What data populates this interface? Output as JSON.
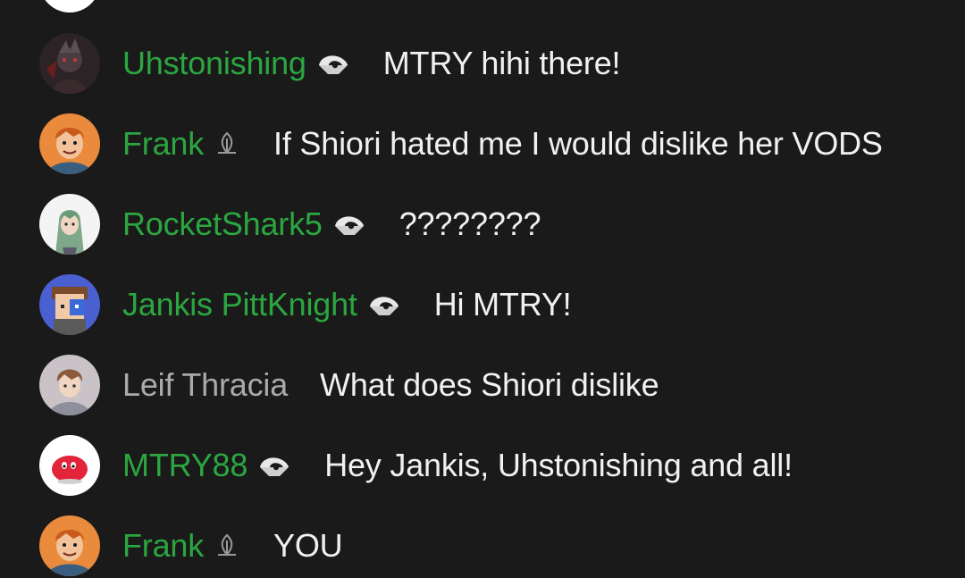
{
  "messages": [
    {
      "author": "Uhstonishing",
      "member": true,
      "badge": "member-badge-icon",
      "text": "MTRY hihi there!"
    },
    {
      "author": "Frank",
      "member": true,
      "badge": "sprout-badge-icon",
      "text": "If Shiori hated me I would dislike her VODS"
    },
    {
      "author": "RocketShark5",
      "member": true,
      "badge": "member-badge-icon",
      "text": "????????"
    },
    {
      "author": "Jankis PittKnight",
      "member": true,
      "badge": "member-badge-icon",
      "text": "Hi MTRY!"
    },
    {
      "author": "Leif Thracia",
      "member": false,
      "badge": "",
      "text": "What does Shiori dislike"
    },
    {
      "author": "MTRY88",
      "member": true,
      "badge": "member-badge-icon",
      "text": "Hey Jankis, Uhstonishing and all!"
    },
    {
      "author": "Frank",
      "member": true,
      "badge": "sprout-badge-icon",
      "text": "YOU"
    }
  ],
  "colors": {
    "background": "#1a1a1a",
    "member_name": "#2ba640",
    "plain_name": "#aaaaaa",
    "message_text": "#f1f1f1"
  }
}
